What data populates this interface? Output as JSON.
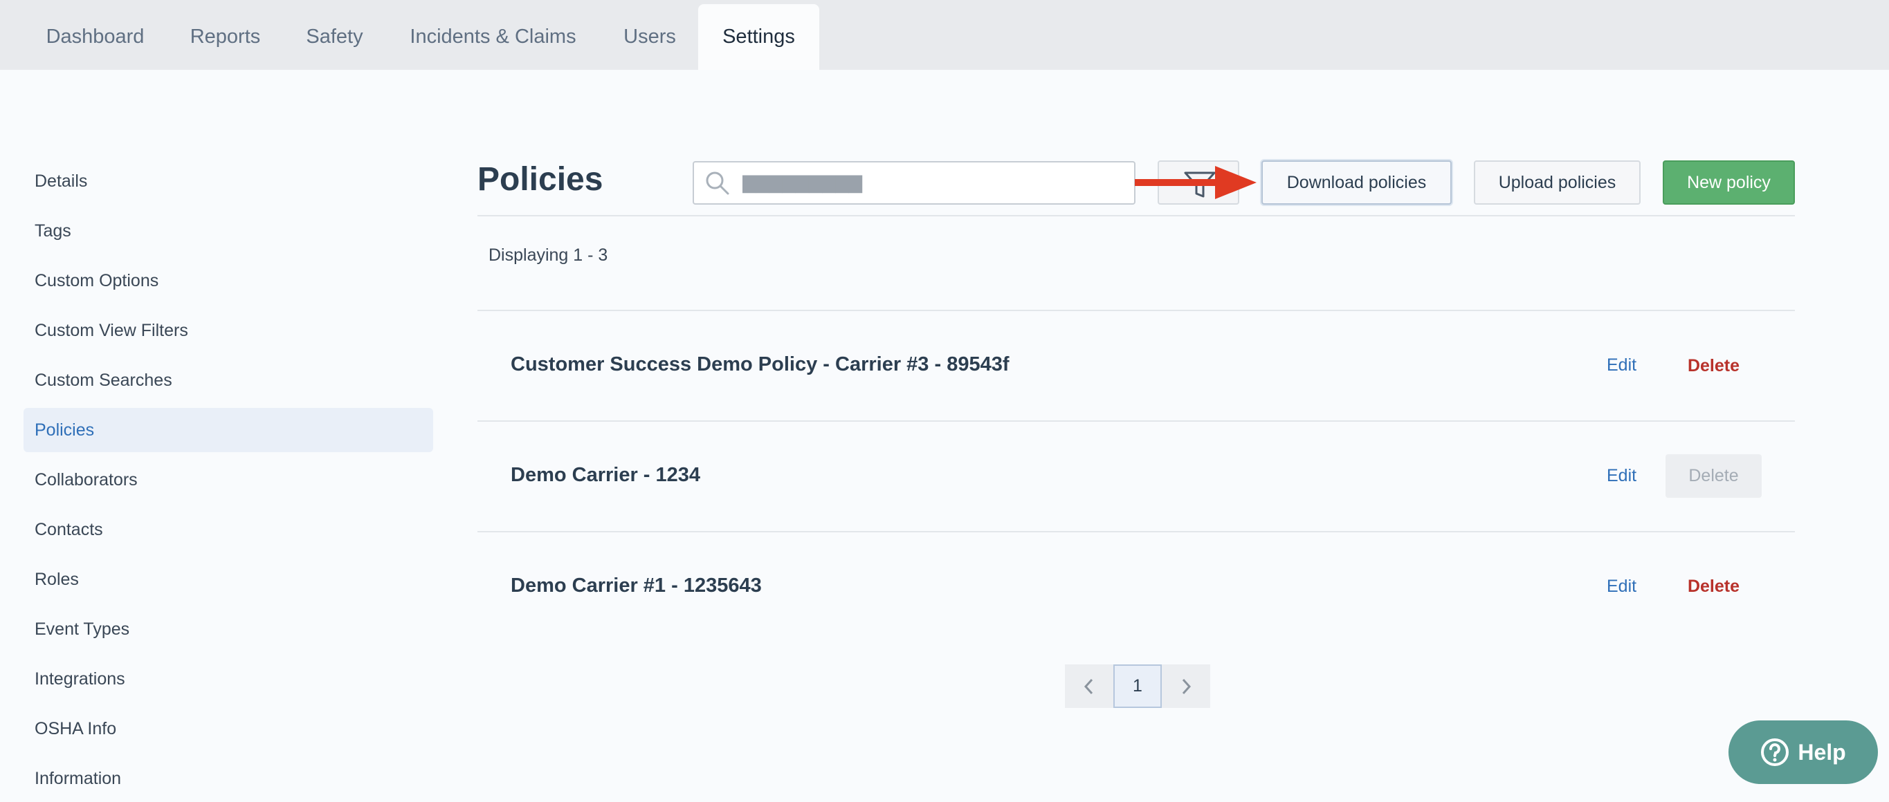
{
  "top_tabs": [
    {
      "label": "Dashboard"
    },
    {
      "label": "Reports"
    },
    {
      "label": "Safety"
    },
    {
      "label": "Incidents & Claims"
    },
    {
      "label": "Users"
    },
    {
      "label": "Settings",
      "active": true
    }
  ],
  "sidebar": {
    "items": [
      {
        "label": "Details"
      },
      {
        "label": "Tags"
      },
      {
        "label": "Custom Options"
      },
      {
        "label": "Custom View Filters"
      },
      {
        "label": "Custom Searches"
      },
      {
        "label": "Policies",
        "active": true
      },
      {
        "label": "Collaborators"
      },
      {
        "label": "Contacts"
      },
      {
        "label": "Roles"
      },
      {
        "label": "Event Types"
      },
      {
        "label": "Integrations"
      },
      {
        "label": "OSHA Info"
      },
      {
        "label": "Information"
      }
    ]
  },
  "header": {
    "title": "Policies",
    "search": {
      "value": "",
      "placeholder": "▇▇▇▇▇▇▇▇▇"
    },
    "filter_icon": "filter-icon",
    "download_label": "Download policies",
    "upload_label": "Upload policies",
    "new_label": "New policy"
  },
  "displaying": "Displaying 1 - 3",
  "policies": [
    {
      "name": "Customer Success Demo Policy - Carrier #3 - 89543f",
      "edit": "Edit",
      "delete": "Delete",
      "delete_disabled": false
    },
    {
      "name": "Demo Carrier - 1234",
      "edit": "Edit",
      "delete": "Delete",
      "delete_disabled": true
    },
    {
      "name": "Demo Carrier #1 - 1235643",
      "edit": "Edit",
      "delete": "Delete",
      "delete_disabled": false
    }
  ],
  "pagination": {
    "current": "1",
    "prev_icon": "chevron-left-icon",
    "next_icon": "chevron-right-icon"
  },
  "help": {
    "label": "Help",
    "icon": "question-circle-icon"
  },
  "colors": {
    "accent": "#2f6fb8",
    "primary_green": "#5cb070",
    "danger": "#b8322b",
    "help_teal": "#5b9b93",
    "annotation_arrow": "#e03a22"
  }
}
